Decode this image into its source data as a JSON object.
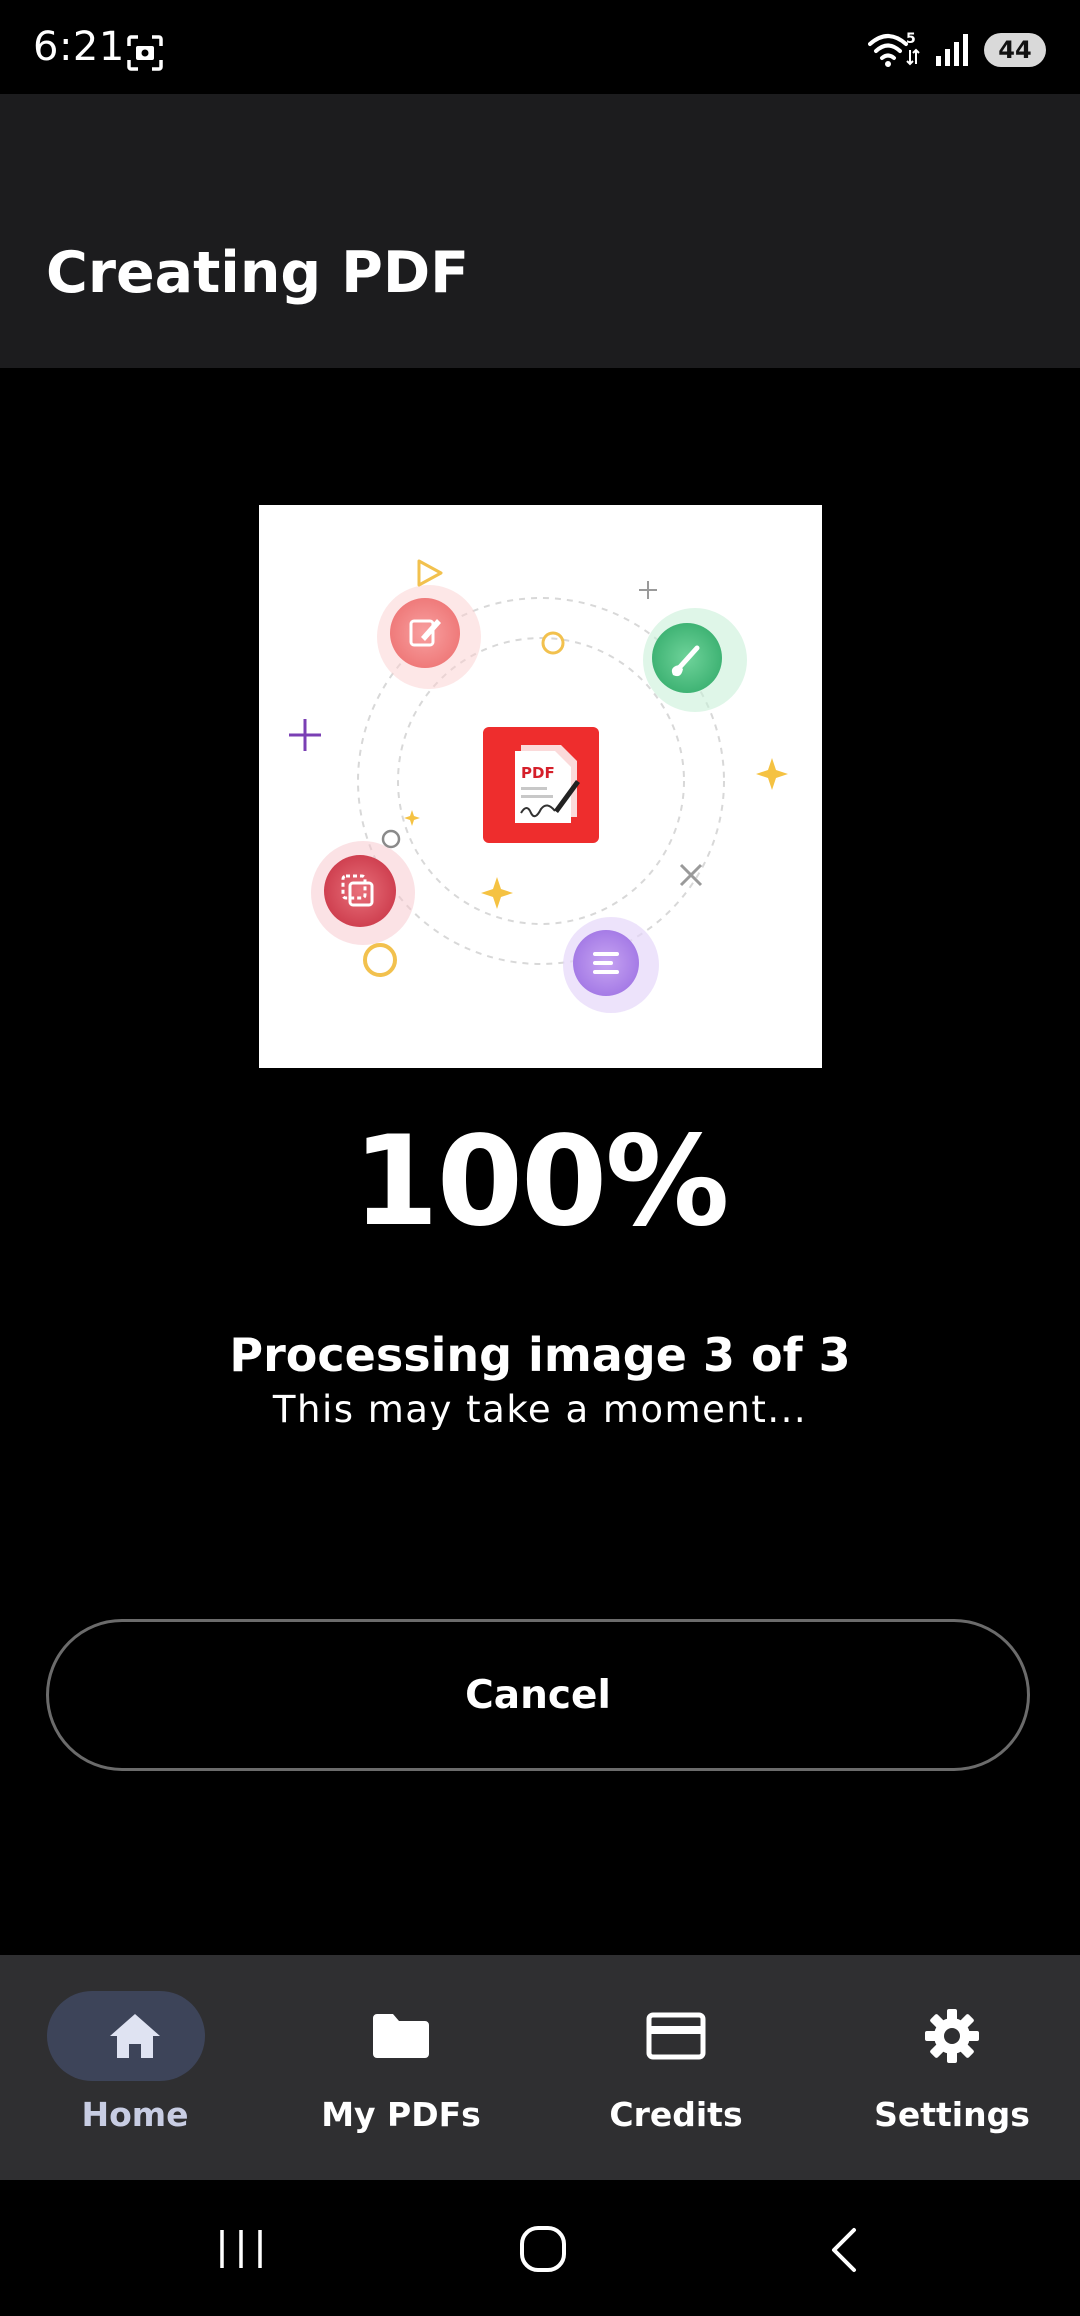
{
  "status_bar": {
    "time": "6:21",
    "battery": "44",
    "icons": [
      "screenshot-icon",
      "wifi-icon",
      "signal-icon",
      "battery-icon"
    ]
  },
  "header": {
    "title": "Creating PDF"
  },
  "illustration": {
    "badge_text": "PDF",
    "icon": "pdf-document-icon"
  },
  "progress": {
    "percent_label": "100%",
    "value": 1.0,
    "title": "Processing image 3 of 3",
    "subtitle": "This may take a moment..."
  },
  "actions": {
    "cancel_label": "Cancel"
  },
  "bottom_nav": {
    "items": [
      {
        "label": "Home",
        "icon": "home-icon",
        "active": true
      },
      {
        "label": "My PDFs",
        "icon": "folder-icon",
        "active": false
      },
      {
        "label": "Credits",
        "icon": "credit-card-icon",
        "active": false
      },
      {
        "label": "Settings",
        "icon": "gear-icon",
        "active": false
      }
    ]
  },
  "system_nav": {
    "icons": [
      "recents-icon",
      "home-circle-icon",
      "back-icon"
    ]
  },
  "colors": {
    "app_bar": "#1c1c1e",
    "nav_bar": "#2f2f31",
    "active_pill": "#3d4459",
    "pdf_red": "#ee2d2d"
  }
}
